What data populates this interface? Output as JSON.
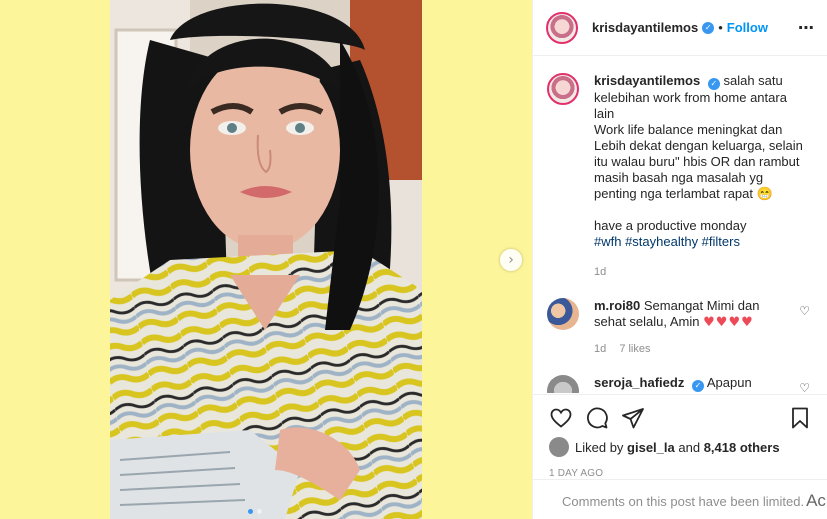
{
  "post": {
    "username": "krisdayantilemos",
    "dot": "•",
    "follow_label": "Follow",
    "more_icon": "⋯"
  },
  "caption": {
    "username": "krisdayantilemos",
    "line1": "salah satu kelebihan work from home antara lain",
    "line2": "Work life balance meningkat dan Lebih dekat dengan keluarga, selain itu walau buru\" hbis OR dan rambut masih basah nga masalah yg penting nga terlambat rapat",
    "emoji": "😁",
    "line3": "have a productive monday",
    "hashtags": "#wfh #stayhealthy #filters",
    "time": "1d"
  },
  "comments": [
    {
      "username": "m.roi80",
      "text": "Semangat Mimi dan sehat selalu, Amin",
      "hearts": "♥♥♥♥",
      "time": "1d",
      "likes": "7 likes"
    },
    {
      "username": "seroja_hafiedz",
      "text": "Apapun"
    }
  ],
  "likes": {
    "prefix": "Liked by",
    "user": "gisel_la",
    "and": "and",
    "count": "8,418 others"
  },
  "timestamp": "1 day ago",
  "comments_limited": "Comments on this post have been limited.",
  "ac_glyph": "Ac",
  "colors": {
    "background": "#fdf59a",
    "accent": "#0095f6",
    "verified": "#3897f0",
    "heart": "#ed4956",
    "muted": "#8e8e8e"
  },
  "icons": [
    "verified-badge-icon",
    "chevron-right-icon",
    "heart-icon",
    "comment-icon",
    "share-icon",
    "bookmark-icon",
    "more-icon"
  ]
}
